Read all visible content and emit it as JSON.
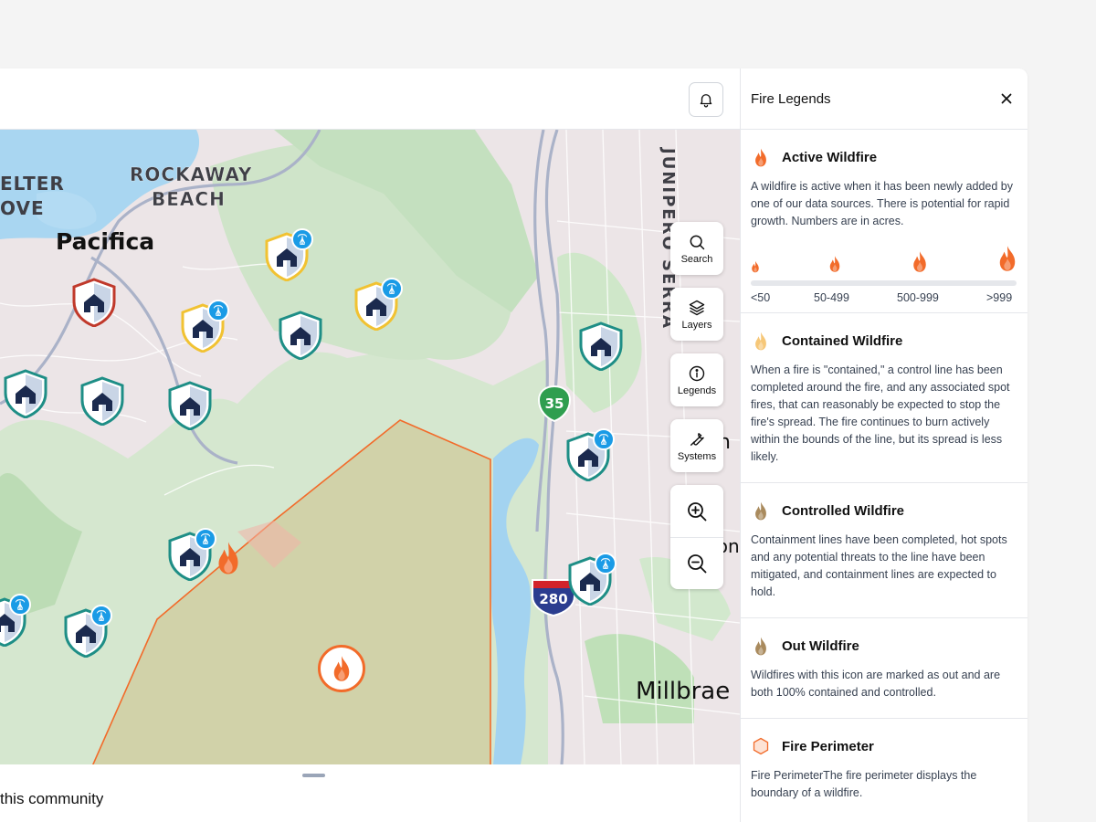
{
  "map": {
    "place_labels": {
      "rockaway_line1": "ROCKAWAY",
      "rockaway_line2": "BEACH",
      "shelter_line1": "ELTER",
      "shelter_line2": "OVE",
      "pacifica": "Pacifica",
      "millbrae": "Millbrae",
      "lomita": "Lon",
      "m_fragment": "n",
      "junipero": "JUNIPERO SERRA"
    },
    "highways": {
      "sr35": "35",
      "i280": "280"
    },
    "controls": [
      {
        "label": "Search",
        "icon": "search-icon"
      },
      {
        "label": "Layers",
        "icon": "layers-icon"
      },
      {
        "label": "Legends",
        "icon": "info-icon"
      },
      {
        "label": "Systems",
        "icon": "wrench-icon"
      }
    ],
    "zoom": {
      "in_icon": "zoom-in-icon",
      "out_icon": "zoom-out-icon"
    }
  },
  "topbar": {
    "bell_icon": "bell-icon"
  },
  "bottom": {
    "community_text": "this community"
  },
  "panel": {
    "title": "Fire Legends",
    "close_label": "×",
    "sections": [
      {
        "title": "Active Wildfire",
        "icon": "fire-active-icon",
        "color": "#f26b2a",
        "description": "A wildfire is active when it has been newly added by one of our data sources. There is potential for rapid growth. Numbers are in acres.",
        "scale": [
          "<50",
          "50-499",
          "500-999",
          ">999"
        ]
      },
      {
        "title": "Contained Wildfire",
        "icon": "fire-contained-icon",
        "color": "#f6c778",
        "description": "When a fire is \"contained,\" a control line has been completed around the fire, and any associated spot fires, that can reasonably be expected to stop the fire's spread. The fire continues to burn actively within the bounds of the line, but its spread is less likely."
      },
      {
        "title": "Controlled Wildfire",
        "icon": "fire-controlled-icon",
        "color": "#a98a5d",
        "description": "Containment lines have been completed, hot spots and any potential threats to the line have been mitigated, and containment lines are expected to hold."
      },
      {
        "title": "Out Wildfire",
        "icon": "fire-out-icon",
        "color": "#a98a5d",
        "description": "Wildfires with this icon are marked as out and are both 100% contained and controlled."
      },
      {
        "title": "Fire Perimeter",
        "icon": "hexagon-icon",
        "color": "#f26b2a",
        "description": "Fire PerimeterThe fire perimeter displays the boundary of a wildfire."
      }
    ]
  },
  "colors": {
    "accent_fire": "#f26b2a",
    "badge_blue": "#1a9be6",
    "shield_teal": "#1e8e86",
    "shield_yellow": "#f1c232",
    "shield_red": "#c0392b",
    "house_navy": "#1b2a4e"
  }
}
